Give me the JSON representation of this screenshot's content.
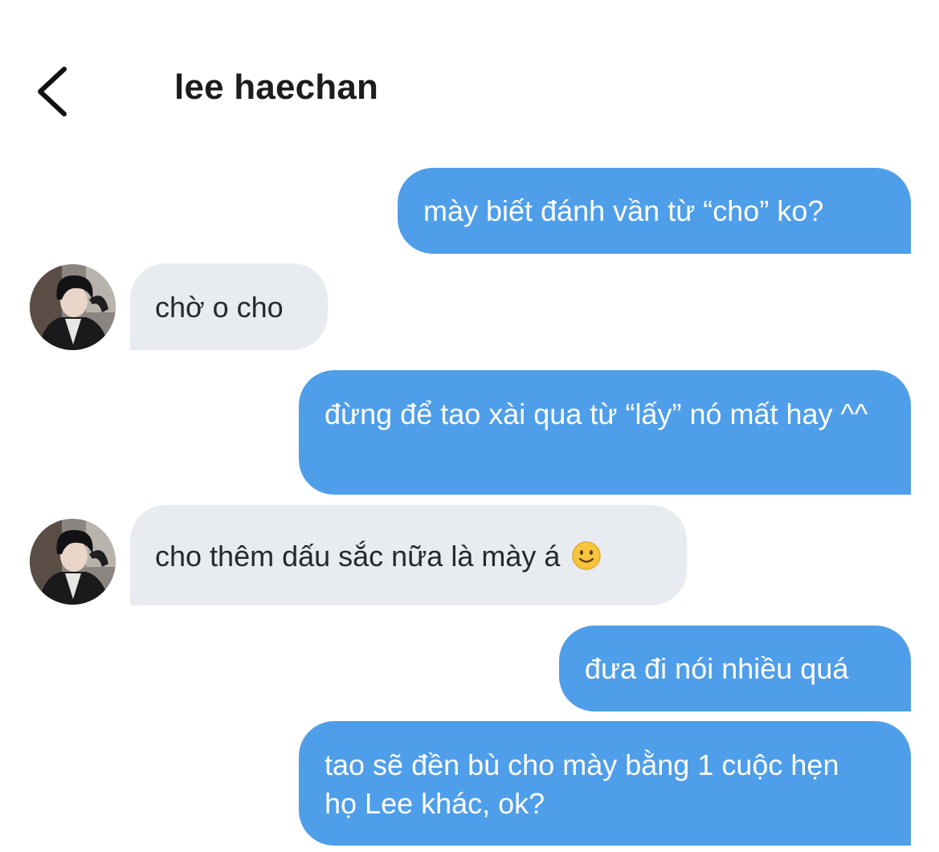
{
  "header": {
    "title": "lee haechan",
    "back_icon": "chevron-left-icon"
  },
  "colors": {
    "outgoing_bubble": "#4f9ee9",
    "incoming_bubble": "#e8ebef"
  },
  "messages": [
    {
      "direction": "out",
      "text": "mày biết đánh vần từ “cho” ko?"
    },
    {
      "direction": "in",
      "text": "chờ o cho"
    },
    {
      "direction": "out",
      "text": "đừng để tao xài qua từ “lấy” nó mất hay ^^"
    },
    {
      "direction": "in",
      "text": "cho thêm dấu sắc nữa là mày á",
      "emoji": "slightly-smiling-face-icon"
    },
    {
      "direction": "out",
      "text": "đưa đi nói nhiều quá"
    },
    {
      "direction": "out",
      "text": "tao sẽ đền bù cho mày bằng 1 cuộc hẹn họ Lee khác, ok?"
    }
  ]
}
